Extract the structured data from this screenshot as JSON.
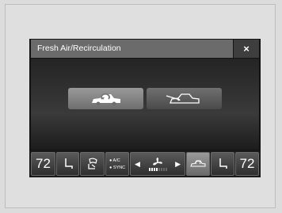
{
  "dialog": {
    "title": "Fresh Air/Recirculation",
    "close_label": "×"
  },
  "modes": [
    {
      "name": "recirculation",
      "icon": "car-recirculation-icon",
      "active": true
    },
    {
      "name": "fresh-air",
      "icon": "car-fresh-air-icon",
      "active": false
    }
  ],
  "bottom_bar": {
    "temp_left": "72",
    "temp_right": "72",
    "ac_label": "A/C",
    "sync_label": "SYNC",
    "fan_level_fraction": 0.5,
    "icons": [
      "seat-heater-left-icon",
      "airflow-mode-icon",
      "fan-icon",
      "recirculation-icon",
      "seat-heater-right-icon"
    ]
  },
  "colors": {
    "active_button": "#8a8a8a",
    "inactive_button": "#5a5a5a",
    "header": "#6b6b6b"
  }
}
